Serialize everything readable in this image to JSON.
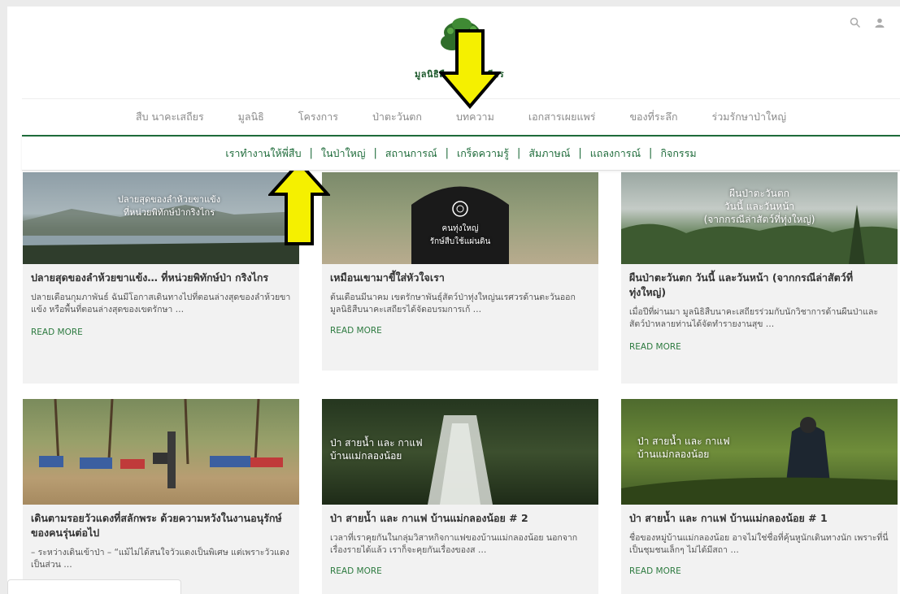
{
  "logo": {
    "text": "มูลนิธิสืบ นาคะเสถียร"
  },
  "top_icons": [
    "search-icon",
    "user-icon"
  ],
  "main_nav": [
    "สืบ นาคะเสถียร",
    "มูลนิธิ",
    "โครงการ",
    "ป่าตะวันตก",
    "บทความ",
    "เอกสารเผยแพร่",
    "ของที่ระลึก",
    "ร่วมรักษาป่าใหญ่"
  ],
  "sub_nav": [
    "เราทำงานให้พี่สืบ",
    "ในป่าใหญ่",
    "สถานการณ์",
    "เกร็ดความรู้",
    "สัมภาษณ์",
    "แถลงการณ์",
    "กิจกรรม"
  ],
  "sub_nav_separator": "|",
  "cards": [
    {
      "image_caption": "ปลายสุดของลำห้วยขาแข้ง\nที่หน่วยพิทักษ์ป่ากริงไกร",
      "title": "ปลายสุดของลำห้วยขาแข้ง… ที่หน่วยพิทักษ์ป่า กริงไกร",
      "excerpt": "ปลายเดือนกุมภาพันธ์ ฉันมีโอกาสเดินทางไปที่ตอนล่างสุดของลำห้วยขาแข้ง หรือพื้นที่ตอนล่างสุดของเขตรักษา …",
      "more": "READ MORE"
    },
    {
      "image_caption": "คนทุ่งใหญ่\nรักษ์สืบใช้แผ่นดิน",
      "title": "เหมือนเขามาขี้ใส่หัวใจเรา",
      "excerpt": "ต้นเดือนมีนาคม เขตรักษาพันธุ์สัตว์ป่าทุ่งใหญ่นเรศวรด้านตะวันออก มูลนิธิสืบนาคะเสถียรได้จัดอบรมการเก้ …",
      "more": "READ MORE"
    },
    {
      "image_caption": "ผืนป่าตะวันตก\nวันนี้ และวันหน้า\n(จากกรณีล่าสัตว์ที่ทุ่งใหญ่)",
      "title": "ผืนป่าตะวันตก วันนี้ และวันหน้า (จากกรณีล่าสัตว์ที่ทุ่งใหญ่)",
      "excerpt": "เมื่อปีที่ผ่านมา มูลนิธิสืบนาคะเสถียรร่วมกับนักวิชาการด้านผืนป่าและสัตว์ป่าหลายท่านได้จัดทำรายงานสุข …",
      "more": "READ MORE"
    },
    {
      "image_caption": "",
      "title": "เดินตามรอยวัวแดงที่สลักพระ ด้วยความหวังในงานอนุรักษ์ของคนรุ่นต่อไป",
      "excerpt": "– ระหว่างเดินเข้าป่า – “แม้ไม่ได้สนใจวัวแดงเป็นพิเศษ แต่เพราะวัวแดงเป็นส่วน …",
      "more": ""
    },
    {
      "image_caption": "ป่า สายน้ำ และ กาแฟ\nบ้านแม่กลองน้อย",
      "title": "ป่า สายน้ำ และ กาแฟ บ้านแม่กลองน้อย # 2",
      "excerpt": "เวลาที่เราคุยกันในกลุ่มวิสาหกิจกาแฟของบ้านแม่กลองน้อย นอกจากเรื่องรายได้แล้ว เราก็จะคุยกันเรื่องของส …",
      "more": "READ MORE"
    },
    {
      "image_caption": "ป่า สายน้ำ และ กาแฟ\nบ้านแม่กลองน้อย",
      "title": "ป่า สายน้ำ และ กาแฟ บ้านแม่กลองน้อย # 1",
      "excerpt": "ชื่อของหมู่บ้านแม่กลองน้อย อาจไม่ใช่ชื่อที่คุ้นหูนักเดินทางนัก เพราะที่นี่เป็นชุมชนเล็กๆ ไม่ได้มีสถา …",
      "more": "READ MORE"
    }
  ],
  "colors": {
    "brand_green": "#1e6b3a",
    "arrow_yellow": "#f5f000"
  }
}
